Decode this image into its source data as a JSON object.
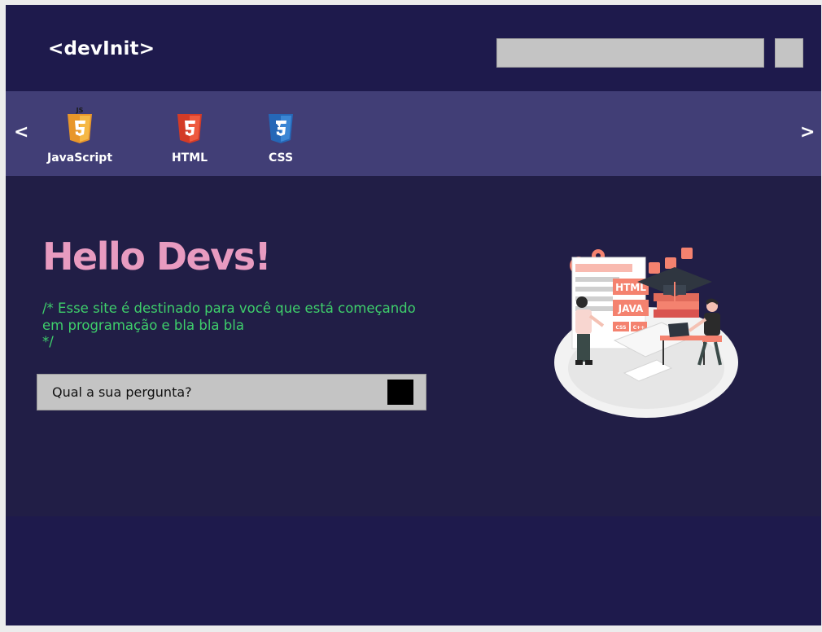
{
  "header": {
    "logo": "<devInit>",
    "search": {
      "value": "",
      "placeholder": ""
    },
    "search_button_label": ""
  },
  "carousel": {
    "prev_arrow": "<",
    "next_arrow": ">",
    "items": [
      {
        "label": "JavaScript",
        "icon": "javascript-shield-icon",
        "color": "#f0a92b"
      },
      {
        "label": "HTML",
        "icon": "html5-shield-icon",
        "color": "#e14a32"
      },
      {
        "label": "CSS",
        "icon": "css3-shield-icon",
        "color": "#2f72c1"
      }
    ]
  },
  "hero": {
    "title": "Hello Devs!",
    "comment_lines": [
      "/* Esse site é destinado para você que está começando",
      "em programação e bla bla bla",
      "*/"
    ],
    "question": {
      "value": "",
      "placeholder": "Qual a sua pergunta?"
    },
    "illustration_labels": [
      "HTML",
      "JAVA",
      "CSS",
      "C++"
    ]
  },
  "colors": {
    "background": "#1f1b4b",
    "carousel": "#413e76",
    "hero": "#211e46",
    "title": "#e89bc0",
    "comment": "#3ecf6b",
    "input": "#c4c4c4",
    "accent": "#f4826f"
  }
}
